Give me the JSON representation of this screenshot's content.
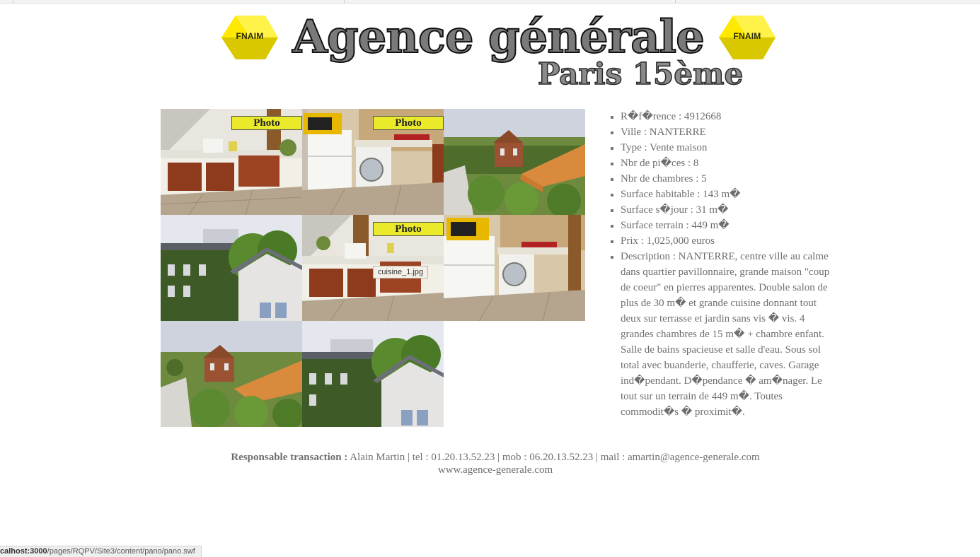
{
  "header": {
    "badge_left": "FNAIM",
    "badge_right": "FNAIM",
    "title": "Agence générale",
    "subtitle": "Paris 15ème"
  },
  "gallery": {
    "tiles": [
      {
        "scene": "kitchen-counter",
        "tag": "Photo"
      },
      {
        "scene": "kitchen-appliances",
        "tag": "Photo"
      },
      {
        "scene": "garden-roofs",
        "tag": ""
      },
      {
        "scene": "ivy-house",
        "tag": ""
      },
      {
        "scene": "kitchen-counter",
        "tag": "Photo"
      },
      {
        "scene": "kitchen-appliances",
        "tag": ""
      },
      {
        "scene": "garden-roofs",
        "tag": ""
      },
      {
        "scene": "ivy-house",
        "tag": ""
      }
    ],
    "tooltip": "cuisine_1.jpg"
  },
  "details": [
    "R�f�rence : 4912668",
    "Ville : NANTERRE",
    "Type : Vente maison",
    "Nbr de pi�ces : 8",
    "Nbr de chambres : 5",
    "Surface habitable : 143 m�",
    "Surface s�jour : 31 m�",
    "Surface terrain : 449 m�",
    "Prix : 1,025,000 euros",
    "Description : NANTERRE, centre ville au calme dans quartier pavillonnaire, grande maison \"coup de coeur\" en pierres apparentes. Double salon de plus de 30 m� et grande cuisine donnant tout deux sur terrasse et jardin sans vis � vis. 4 grandes chambres de 15 m� + chambre enfant. Salle de bains spacieuse et salle d'eau. Sous sol total avec buanderie, chaufferie, caves. Garage ind�pendant. D�pendance � am�nager. Le tout sur un terrain de 449 m�. Toutes commodit�s � proximit�."
  ],
  "footer": {
    "contact_label": "Responsable transaction :",
    "contact_text": "Alain Martin | tel : 01.20.13.52.23 | mob : 06.20.13.52.23 | mail : amartin@agence-generale.com",
    "website": "www.agence-generale.com"
  },
  "status_bar": {
    "host": "calhost:3000",
    "path": "/pages/RQPV/Site3/content/pano/pano.swf"
  },
  "colors": {
    "badge_yellow": "#f2e600",
    "photo_tag": "#eaea2a",
    "text": "#6e6e6e"
  }
}
